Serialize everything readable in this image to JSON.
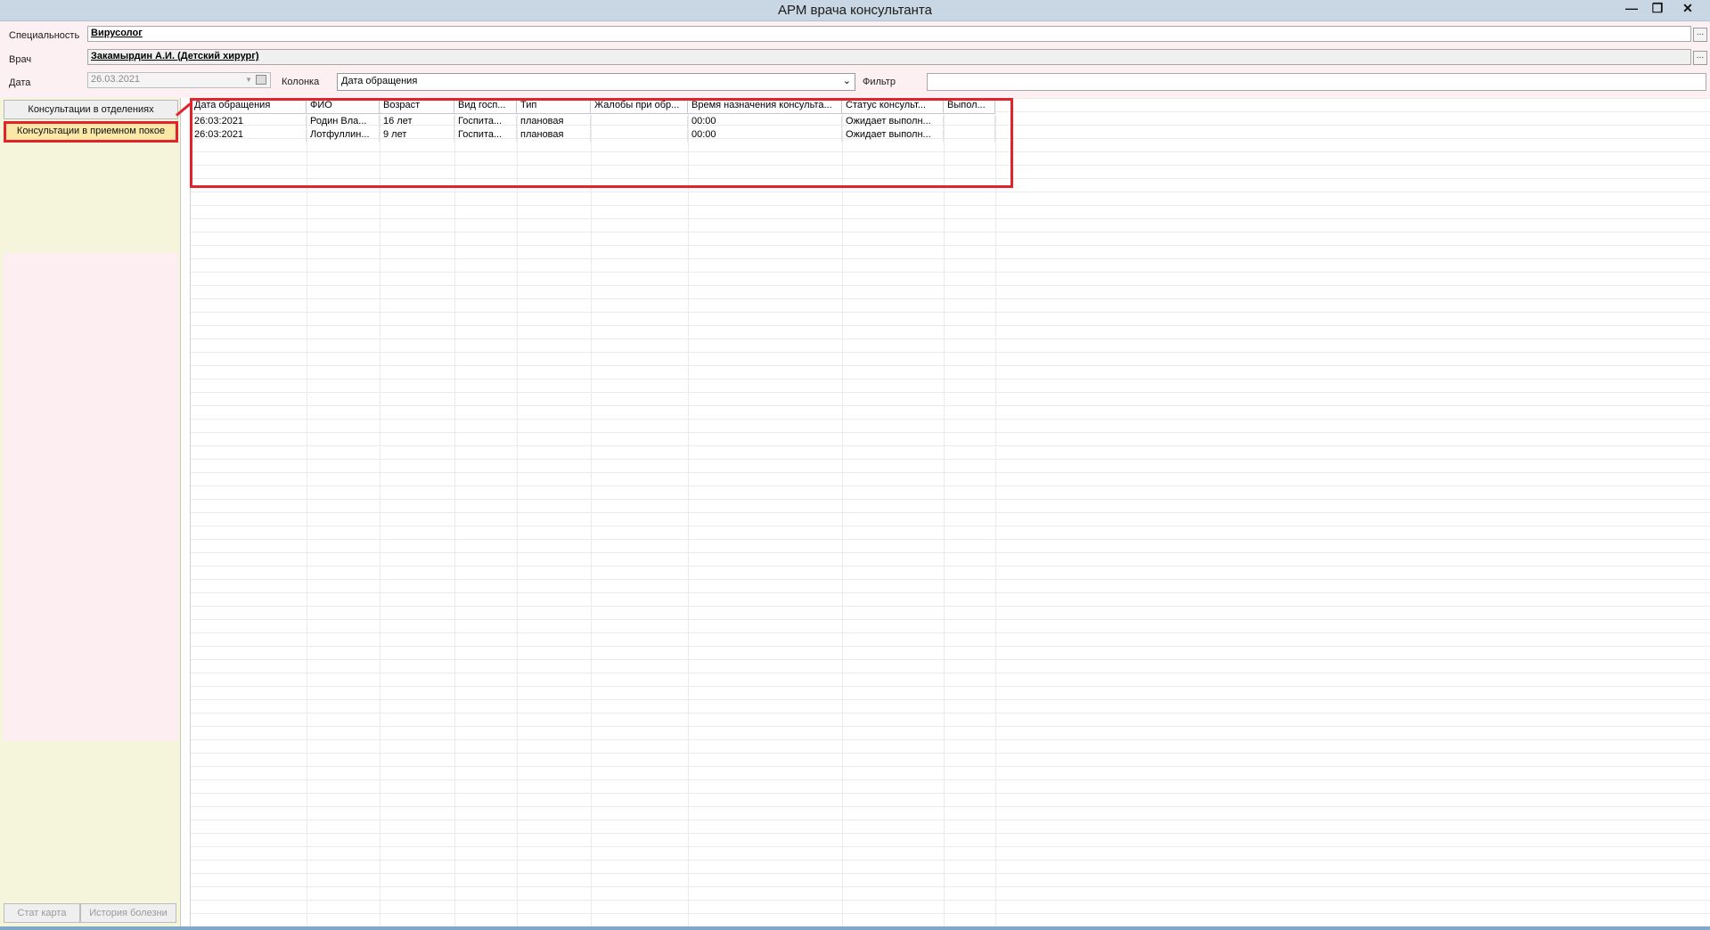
{
  "window": {
    "title": "АРМ врача консультанта",
    "min": "—",
    "max": "❐",
    "close": "✕"
  },
  "filters": {
    "specialty_label": "Специальность",
    "specialty_value": "Вирусолог",
    "doctor_label": "Врач",
    "doctor_value": "Закамырдин А.И. (Детский хирург)",
    "date_label": "Дата",
    "date_value": "26.03.2021",
    "column_label": "Колонка",
    "column_value": "Дата обращения",
    "filter_label": "Фильтр",
    "filter_value": "",
    "ellipsis": "..."
  },
  "sidebar": {
    "items": [
      {
        "label": "Консультации в отделениях"
      },
      {
        "label": "Консультации в приемном покое"
      }
    ],
    "stat_card": "Стат карта",
    "history": "История болезни"
  },
  "table": {
    "headers": [
      "Дата обращения",
      "ФИО",
      "Возраст",
      "Вид госп...",
      "Тип",
      "Жалобы при обр...",
      "Время назначения консульта...",
      "Статус консульт...",
      "Выпол..."
    ],
    "rows": [
      [
        "26:03:2021",
        "Родин Вла...",
        "16 лет",
        "Госпита...",
        "плановая",
        "",
        "00:00",
        "Ожидает выполн...",
        ""
      ],
      [
        "26:03:2021",
        "Лотфуллин...",
        "9 лет",
        "Госпита...",
        "плановая",
        "",
        "00:00",
        "Ожидает выполн...",
        ""
      ]
    ]
  },
  "colors": {
    "highlight": "#e1242c",
    "selected_bg": "#fce8a6",
    "sidebar_bg": "#f5f5dc",
    "topbar_bg": "#fdf0f2"
  }
}
